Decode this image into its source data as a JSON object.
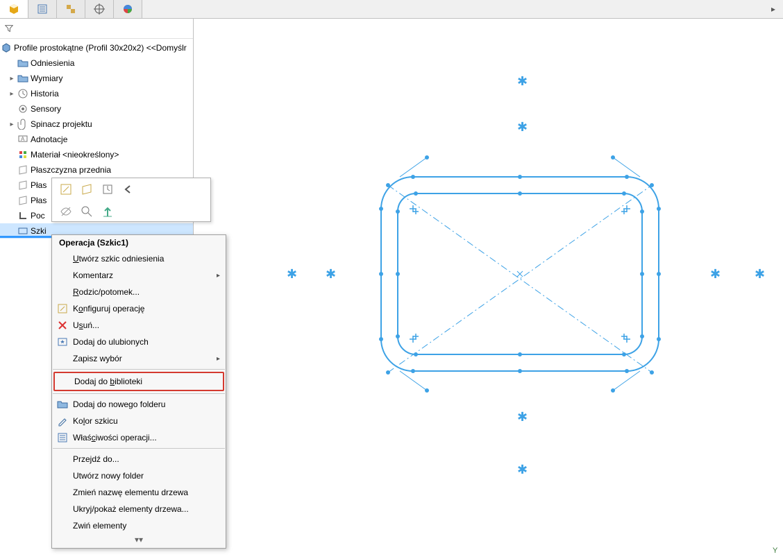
{
  "root_label": "Profile prostokątne (Profil 30x20x2) <<Domyślr",
  "tree": {
    "odniesienia": "Odniesienia",
    "wymiary": "Wymiary",
    "historia": "Historia",
    "sensory": "Sensory",
    "spinacz": "Spinacz projektu",
    "adnotacje": "Adnotacje",
    "material": "Materiał <nieokreślony>",
    "plaszczyzna_przednia": "Płaszczyzna przednia",
    "plas1": "Płas",
    "plas2": "Płas",
    "poc": "Poc",
    "szkic": "Szki"
  },
  "ctx": {
    "header": "Operacja (Szkic1)",
    "utworz_szkic": "Utwórz szkic odniesienia",
    "komentarz": "Komentarz",
    "rodzic": "Rodzic/potomek...",
    "konfiguruj": "Konfiguruj operację",
    "usun": "Usuń...",
    "dodaj_ulub": "Dodaj do ulubionych",
    "zapisz_wybor": "Zapisz wybór",
    "dodaj_bibl": "Dodaj do biblioteki",
    "dodaj_folder": "Dodaj do nowego folderu",
    "kolor_szkicu": "Kolor szkicu",
    "wlasciwosci": "Właściwości operacji...",
    "przejdz": "Przejdź do...",
    "utworz_folder": "Utwórz nowy folder",
    "zmien_nazwe": "Zmień nazwę elementu drzewa",
    "ukryj_pokaz": "Ukryj/pokaż elementy drzewa...",
    "zwin": "Zwiń elementy"
  },
  "axis_label": "Y"
}
